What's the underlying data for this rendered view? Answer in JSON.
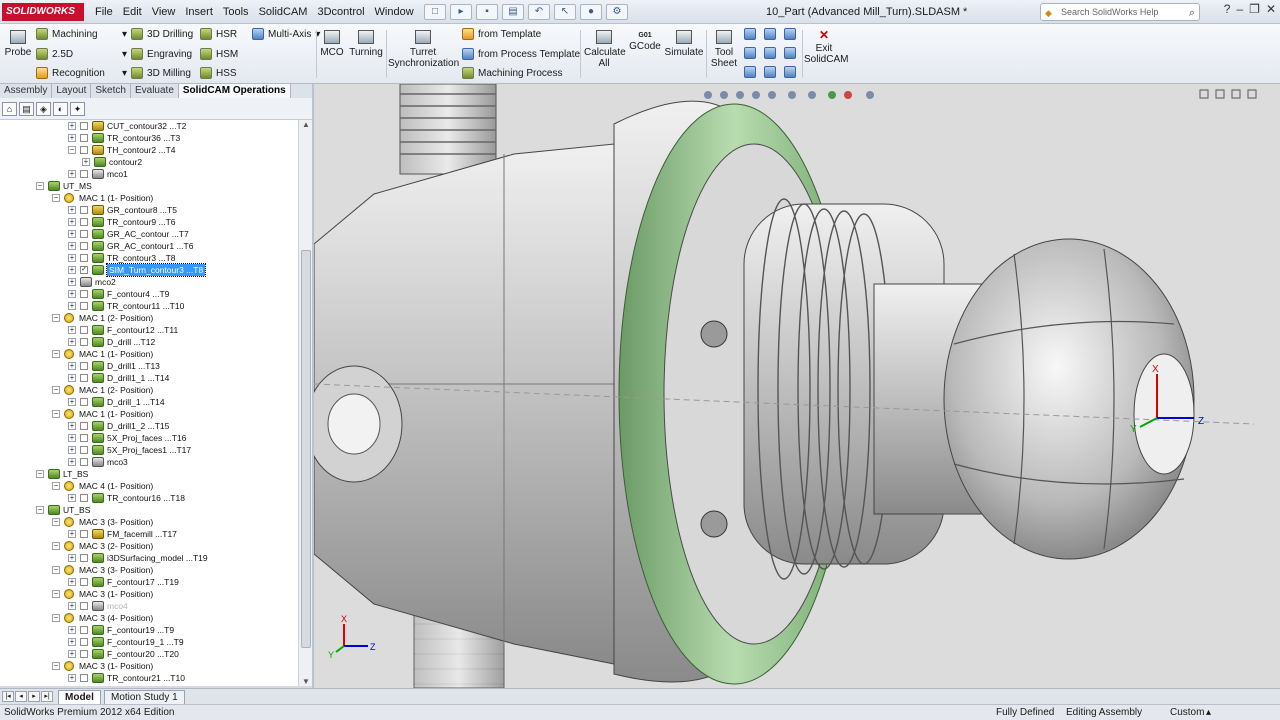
{
  "app": {
    "logo_text": "SOLIDWORKS",
    "document_title": "10_Part (Advanced Mill_Turn).SLDASM *"
  },
  "menu": [
    "File",
    "Edit",
    "View",
    "Insert",
    "Tools",
    "SolidCAM",
    "3Dcontrol",
    "Window",
    "Help"
  ],
  "search": {
    "placeholder": "Search SolidWorks Help"
  },
  "ribbon": {
    "probe": "Probe",
    "col1": [
      "Machining",
      "2.5D",
      "Recognition"
    ],
    "col2": [
      "3D Drilling",
      "Engraving",
      "3D Milling"
    ],
    "col3": [
      "HSR",
      "HSM",
      "HSS"
    ],
    "multiaxis": "Multi-Axis",
    "mco": "MCO",
    "turning": "Turning",
    "turret": "Turret Synchronization",
    "templates": [
      "from Template",
      "from Process Template",
      "Machining Process"
    ],
    "calculate": "Calculate All",
    "gcode": "GCode",
    "gcode_badge": "G01",
    "simulate": "Simulate",
    "toolsheet": "Tool Sheet",
    "exit": "Exit SolidCAM"
  },
  "panel_tabs": [
    "Assembly",
    "Layout",
    "Sketch",
    "Evaluate",
    "SolidCAM Operations"
  ],
  "tree": [
    {
      "label": "CUT_contour32 ...T2",
      "level": 3,
      "icon": "tool",
      "check": true
    },
    {
      "label": "TR_contour36 ...T3",
      "level": 3,
      "icon": "green",
      "check": true
    },
    {
      "label": "TH_contour2 ...T4",
      "level": 3,
      "icon": "tool",
      "check": true,
      "expanded": true
    },
    {
      "label": "contour2",
      "level": 4,
      "icon": "sketch",
      "check": false
    },
    {
      "label": "mco1",
      "level": 3,
      "icon": "mco",
      "check": true
    },
    {
      "label": "UT_MS",
      "level": 1,
      "icon": "setup",
      "expanded": true
    },
    {
      "label": "MAC 1 (1- Position)",
      "level": 2,
      "icon": "mac",
      "expanded": true
    },
    {
      "label": "GR_contour8 ...T5",
      "level": 3,
      "icon": "tool",
      "check": true
    },
    {
      "label": "TR_contour9 ...T6",
      "level": 3,
      "icon": "green",
      "check": true
    },
    {
      "label": "GR_AC_contour ...T7",
      "level": 3,
      "icon": "green",
      "check": true
    },
    {
      "label": "GR_AC_contour1 ...T6",
      "level": 3,
      "icon": "green",
      "check": true
    },
    {
      "label": "TR_contour3 ...T8",
      "level": 3,
      "icon": "green",
      "check": true
    },
    {
      "label": "SIM_Turn_contour3 ...T8",
      "level": 3,
      "icon": "green",
      "check": true,
      "checked": true,
      "selected": true
    },
    {
      "label": "mco2",
      "level": 3,
      "icon": "mco",
      "check": false
    },
    {
      "label": "F_contour4 ...T9",
      "level": 3,
      "icon": "green",
      "check": true
    },
    {
      "label": "TR_contour11 ...T10",
      "level": 3,
      "icon": "green",
      "check": true
    },
    {
      "label": "MAC 1 (2- Position)",
      "level": 2,
      "icon": "mac",
      "expanded": true
    },
    {
      "label": "F_contour12 ...T11",
      "level": 3,
      "icon": "green",
      "check": true
    },
    {
      "label": "D_drill ...T12",
      "level": 3,
      "icon": "drill",
      "check": true
    },
    {
      "label": "MAC 1 (1- Position)",
      "level": 2,
      "icon": "mac",
      "expanded": true
    },
    {
      "label": "D_drill1 ...T13",
      "level": 3,
      "icon": "drill",
      "check": true
    },
    {
      "label": "D_drill1_1 ...T14",
      "level": 3,
      "icon": "drill",
      "check": true
    },
    {
      "label": "MAC 1 (2- Position)",
      "level": 2,
      "icon": "mac",
      "expanded": true
    },
    {
      "label": "D_drill_1 ...T14",
      "level": 3,
      "icon": "drill",
      "check": true
    },
    {
      "label": "MAC 1 (1- Position)",
      "level": 2,
      "icon": "mac",
      "expanded": true
    },
    {
      "label": "D_drill1_2 ...T15",
      "level": 3,
      "icon": "drill",
      "check": true
    },
    {
      "label": "5X_Proj_faces ...T16",
      "level": 3,
      "icon": "green",
      "check": true
    },
    {
      "label": "5X_Proj_faces1 ...T17",
      "level": 3,
      "icon": "green",
      "check": true
    },
    {
      "label": "mco3",
      "level": 3,
      "icon": "mco",
      "check": true
    },
    {
      "label": "LT_BS",
      "level": 1,
      "icon": "setup",
      "expanded": true
    },
    {
      "label": "MAC 4 (1- Position)",
      "level": 2,
      "icon": "mac",
      "expanded": true
    },
    {
      "label": "TR_contour16 ...T18",
      "level": 3,
      "icon": "green",
      "check": true
    },
    {
      "label": "UT_BS",
      "level": 1,
      "icon": "setup",
      "expanded": true
    },
    {
      "label": "MAC 3 (3- Position)",
      "level": 2,
      "icon": "mac",
      "expanded": true
    },
    {
      "label": "FM_facemill ...T17",
      "level": 3,
      "icon": "tool",
      "check": true
    },
    {
      "label": "MAC 3 (2- Position)",
      "level": 2,
      "icon": "mac",
      "expanded": true
    },
    {
      "label": "i3DSurfacing_model ...T19",
      "level": 3,
      "icon": "green",
      "check": true
    },
    {
      "label": "MAC 3 (3- Position)",
      "level": 2,
      "icon": "mac",
      "expanded": true
    },
    {
      "label": "F_contour17 ...T19",
      "level": 3,
      "icon": "green",
      "check": true
    },
    {
      "label": "MAC 3 (1- Position)",
      "level": 2,
      "icon": "mac",
      "expanded": true
    },
    {
      "label": "mco4",
      "level": 3,
      "icon": "mco",
      "check": true,
      "dim": true
    },
    {
      "label": "MAC 3 (4- Position)",
      "level": 2,
      "icon": "mac",
      "expanded": true
    },
    {
      "label": "F_contour19 ...T9",
      "level": 3,
      "icon": "green",
      "check": true
    },
    {
      "label": "F_contour19_1 ...T9",
      "level": 3,
      "icon": "green",
      "check": true
    },
    {
      "label": "F_contour20 ...T20",
      "level": 3,
      "icon": "green",
      "check": true
    },
    {
      "label": "MAC 3 (1- Position)",
      "level": 2,
      "icon": "mac",
      "expanded": true
    },
    {
      "label": "TR_contour21 ...T10",
      "level": 3,
      "icon": "green",
      "check": true
    }
  ],
  "viewport": {
    "axis_small": {
      "x": "X",
      "y": "Y",
      "z": "Z"
    },
    "axis_main": {
      "x": "X",
      "y": "Y",
      "z": "Z"
    }
  },
  "bottom_tabs": [
    "Model",
    "Motion Study 1"
  ],
  "status": {
    "edition": "SolidWorks Premium 2012 x64 Edition",
    "state": "Fully Defined",
    "mode": "Editing Assembly",
    "units": "Custom"
  },
  "colors": {
    "accent": "#3399ff",
    "logo": "#c8102e",
    "feature_green": "#8fc08a"
  }
}
